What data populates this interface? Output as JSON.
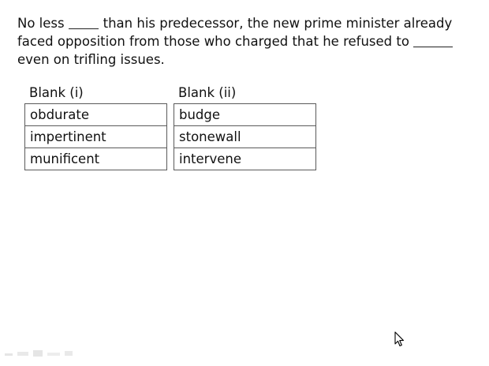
{
  "question": {
    "line1_before": "No less",
    "line1_after": "than his predecessor, the new prime minister already",
    "line2_before": "faced opposition from those who charged that he refused to",
    "line3": "even on trifling issues."
  },
  "blank_i": {
    "header": "Blank (i)",
    "options": [
      "obdurate",
      "impertinent",
      "munificent"
    ]
  },
  "blank_ii": {
    "header": "Blank (ii)",
    "options": [
      "budge",
      "stonewall",
      "intervene"
    ]
  }
}
